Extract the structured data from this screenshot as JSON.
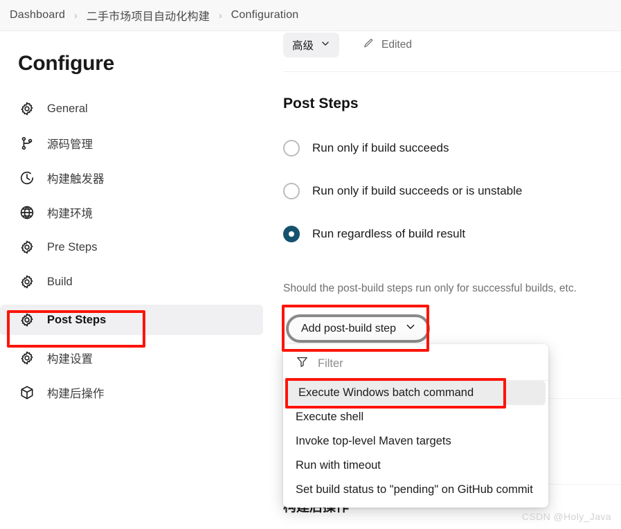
{
  "breadcrumb": {
    "separator": "›",
    "items": [
      {
        "label": "Dashboard"
      },
      {
        "label": "二手市场项目自动化构建"
      },
      {
        "label": "Configuration"
      }
    ]
  },
  "sidebar": {
    "title": "Configure",
    "items": [
      {
        "label": "General",
        "icon": "gear-icon",
        "selected": false
      },
      {
        "label": "源码管理",
        "icon": "git-branch-icon",
        "selected": false
      },
      {
        "label": "构建触发器",
        "icon": "clock-icon",
        "selected": false
      },
      {
        "label": "构建环境",
        "icon": "globe-icon",
        "selected": false
      },
      {
        "label": "Pre Steps",
        "icon": "gear-icon",
        "selected": false
      },
      {
        "label": "Build",
        "icon": "gear-icon",
        "selected": false
      },
      {
        "label": "Post Steps",
        "icon": "gear-icon",
        "selected": true
      },
      {
        "label": "构建设置",
        "icon": "gear-icon",
        "selected": false
      },
      {
        "label": "构建后操作",
        "icon": "package-icon",
        "selected": false
      }
    ]
  },
  "main": {
    "advanced_button": {
      "label": "高级",
      "chevron": "chevron-down-icon"
    },
    "edited_status": {
      "label": "Edited",
      "icon": "pencil-icon"
    },
    "section_title": "Post Steps",
    "radio_options": [
      {
        "label": "Run only if build succeeds",
        "checked": false
      },
      {
        "label": "Run only if build succeeds or is unstable",
        "checked": false
      },
      {
        "label": "Run regardless of build result",
        "checked": true
      }
    ],
    "helper_text": "Should the post-build steps run only for successful builds, etc.",
    "add_step_button": {
      "label": "Add post-build step",
      "chevron": "chevron-down-icon"
    },
    "background_heading": "构建后操作"
  },
  "dropdown": {
    "filter": {
      "placeholder": "Filter",
      "value": "",
      "icon": "funnel-icon"
    },
    "items": [
      {
        "label": "Execute Windows batch command",
        "highlighted": true
      },
      {
        "label": "Execute shell",
        "highlighted": false
      },
      {
        "label": "Invoke top-level Maven targets",
        "highlighted": false
      },
      {
        "label": "Run with timeout",
        "highlighted": false
      },
      {
        "label": "Set build status to \"pending\" on GitHub commit",
        "highlighted": false
      }
    ]
  },
  "annotations": {
    "color": "#fc1407",
    "boxes": [
      "post-steps-nav-item",
      "add-post-build-step-button",
      "execute-windows-batch-command-item"
    ]
  },
  "watermark": "CSDN @Holy_Java"
}
